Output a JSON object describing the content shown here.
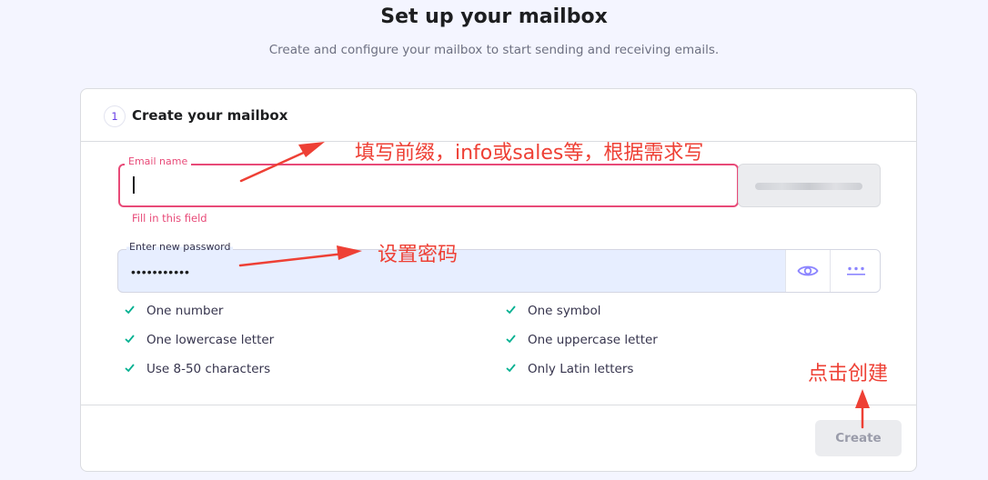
{
  "page": {
    "title": "Set up your mailbox",
    "subtitle": "Create and configure your mailbox to start sending and receiving emails."
  },
  "card": {
    "step_number": "1",
    "title": "Create your mailbox"
  },
  "form": {
    "email_label": "Email name",
    "email_value": "",
    "email_error": "Fill in this field",
    "password_label": "Enter new password",
    "password_value": "•••••••••••"
  },
  "requirements": [
    "One number",
    "One symbol",
    "One lowercase letter",
    "One uppercase letter",
    "Use 8-50 characters",
    "Only Latin letters"
  ],
  "buttons": {
    "create_label": "Create"
  },
  "annotations": {
    "email_note": "填写前缀，info或sales等，根据需求写",
    "password_note": "设置密码",
    "create_note": "点击创建"
  },
  "icons": {
    "eye": "eye-icon",
    "generate": "dots-icon",
    "check": "check-icon",
    "arrow": "arrow-icon"
  },
  "colors": {
    "accent": "#673de6",
    "error": "#e84a78",
    "success": "#00b090",
    "annotation": "#ee4035"
  }
}
